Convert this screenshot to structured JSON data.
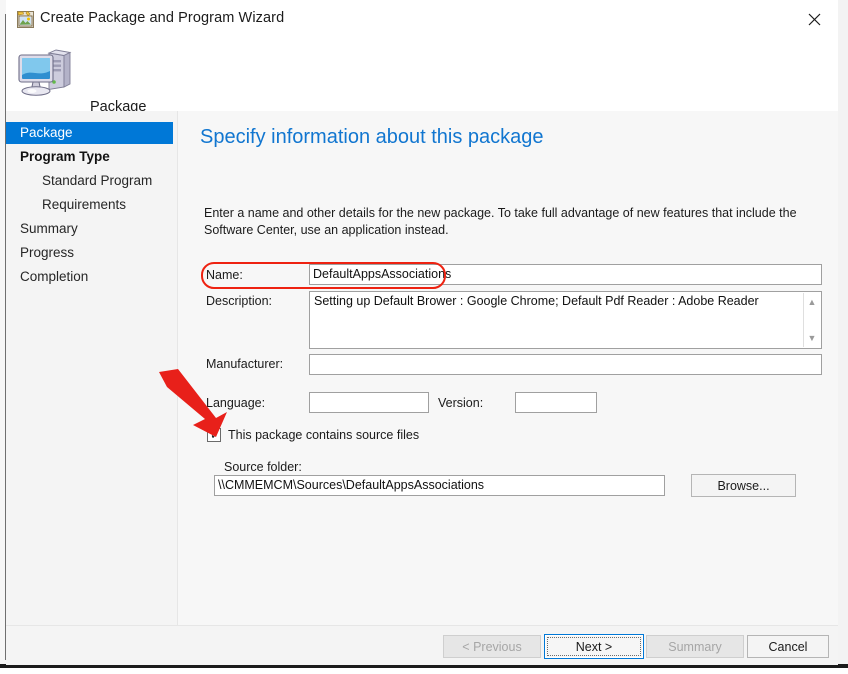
{
  "window": {
    "title": "Create Package and Program Wizard",
    "title_icon": "wizard-package-icon",
    "close_label": "✕"
  },
  "header": {
    "label": "Package",
    "icon": "computer-monitor-icon"
  },
  "sidebar": {
    "items": [
      {
        "label": "Package",
        "level": 1,
        "selected": true,
        "bold": false
      },
      {
        "label": "Program Type",
        "level": 1,
        "selected": false,
        "bold": true
      },
      {
        "label": "Standard Program",
        "level": 2,
        "selected": false,
        "bold": false
      },
      {
        "label": "Requirements",
        "level": 2,
        "selected": false,
        "bold": false
      },
      {
        "label": "Summary",
        "level": 1,
        "selected": false,
        "bold": false
      },
      {
        "label": "Progress",
        "level": 1,
        "selected": false,
        "bold": false
      },
      {
        "label": "Completion",
        "level": 1,
        "selected": false,
        "bold": false
      }
    ]
  },
  "content": {
    "page_title": "Specify information about this package",
    "intro_text": "Enter a name and other details for the new package. To take full advantage of new features that include the Software Center, use an application instead.",
    "fields": {
      "name_label": "Name:",
      "name_value": "DefaultAppsAssociations",
      "description_label": "Description:",
      "description_value": "Setting up Default Brower : Google Chrome; Default Pdf Reader : Adobe Reader",
      "manufacturer_label": "Manufacturer:",
      "manufacturer_value": "",
      "language_label": "Language:",
      "language_value": "",
      "version_label": "Version:",
      "version_value": "",
      "source_checkbox_label": "This package contains source files",
      "source_checkbox_checked": true,
      "source_checkbox_mark": "✓",
      "source_folder_label": "Source folder:",
      "source_folder_value": "\\\\CMMEMCM\\Sources\\DefaultAppsAssociations",
      "browse_label": "Browse..."
    },
    "scroll_up_glyph": "▲",
    "scroll_down_glyph": "▼"
  },
  "footer": {
    "previous_label": "< Previous",
    "next_label": "Next >",
    "summary_label": "Summary",
    "cancel_label": "Cancel"
  },
  "annotations": {
    "name_highlight_color": "#ee2211",
    "arrow_color": "#e8201a",
    "arrow_target": "source-files-checkbox"
  },
  "colors": {
    "accent_blue": "#0078d7",
    "title_blue": "#1176d0",
    "pane_background": "#f7f7f7",
    "sidebar_background": "#f4f4f4"
  }
}
